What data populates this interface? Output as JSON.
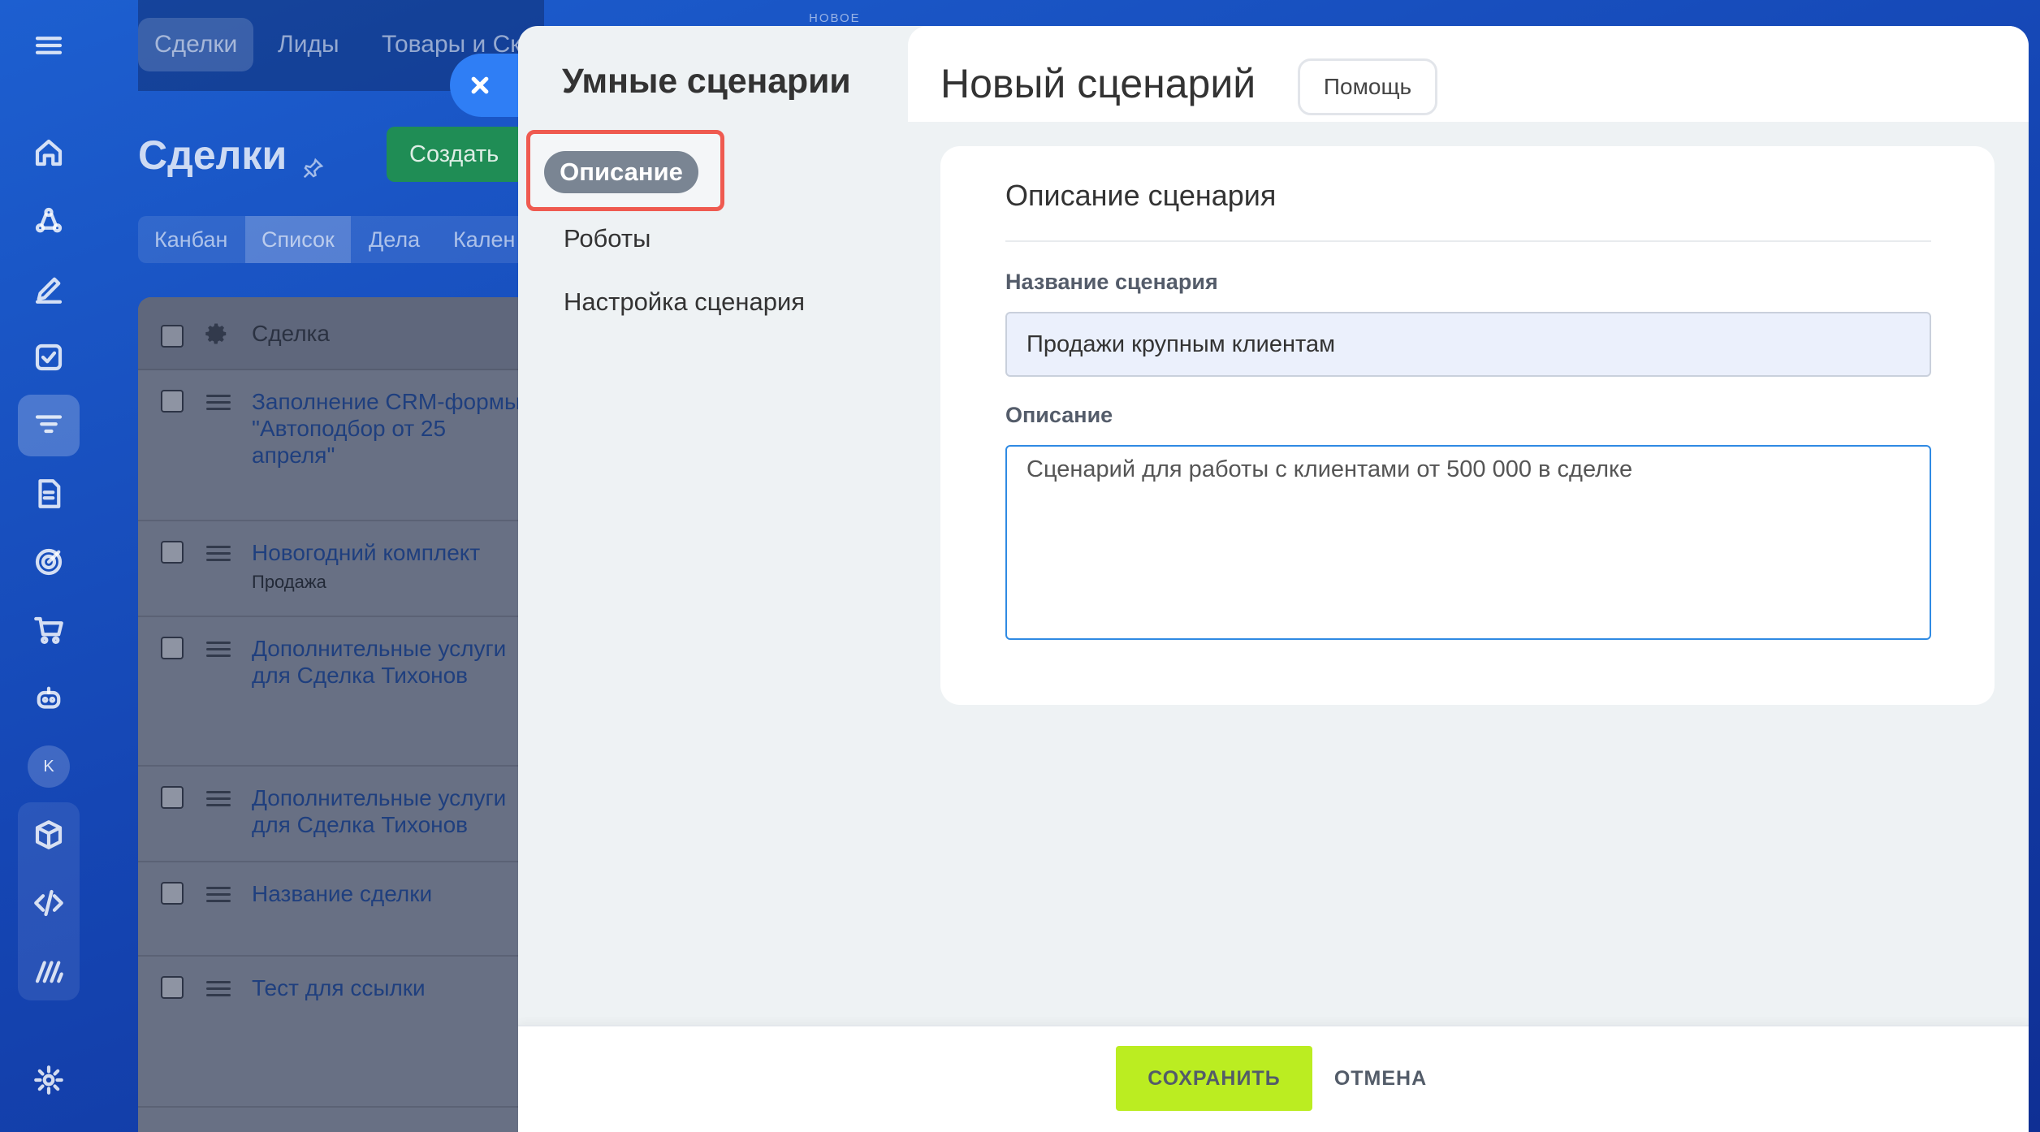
{
  "background": {
    "top_tabs": [
      "Сделки",
      "Лиды",
      "Товары и Ск"
    ],
    "page_title": "Сделки",
    "create_label": "Создать",
    "views": [
      "Канбан",
      "Список",
      "Дела",
      "Кален"
    ],
    "table_header": "Сделка",
    "rows": [
      {
        "title": "Заполнение CRM-формы\n\"Автоподбор от 25\nапреля\"",
        "sub": ""
      },
      {
        "title": "Новогодний комплект",
        "sub": "Продажа"
      },
      {
        "title": "Дополнительные услуги\nдля Сделка Тихонов",
        "sub": ""
      },
      {
        "title": "Дополнительные услуги\nдля Сделка Тихонов",
        "sub": ""
      },
      {
        "title": "Название сделки",
        "sub": ""
      },
      {
        "title": "Тест для ссылки",
        "sub": ""
      }
    ],
    "new_badge": "НОВОЕ"
  },
  "sidebar": {
    "avatar_letter": "K",
    "icons": [
      "menu-icon",
      "home-icon",
      "crm-icon",
      "edit-icon",
      "tasks-icon",
      "funnel-icon",
      "document-icon",
      "target-icon",
      "cart-icon",
      "robot-icon",
      "box-icon",
      "code-icon",
      "marketplace-icon",
      "settings-icon"
    ]
  },
  "slider": {
    "title": "Умные сценарии",
    "nav": {
      "active": "Описание",
      "items": [
        "Роботы",
        "Настройка сценария"
      ]
    },
    "header": {
      "title": "Новый сценарий",
      "help_label": "Помощь"
    },
    "form": {
      "section_title": "Описание сценария",
      "name_label": "Название сценария",
      "name_value": "Продажи крупным клиентам",
      "description_label": "Описание",
      "description_value": "Сценарий для работы с клиентами от 500 000 в сделке"
    },
    "footer": {
      "save_label": "СОХРАНИТЬ",
      "cancel_label": "ОТМЕНА"
    }
  },
  "colors": {
    "background_blue": "#1546b4",
    "accent_blue": "#2f7ef5",
    "highlight_red": "#ef5a50",
    "save_green": "#bbed21",
    "create_green": "#1f8d55"
  }
}
